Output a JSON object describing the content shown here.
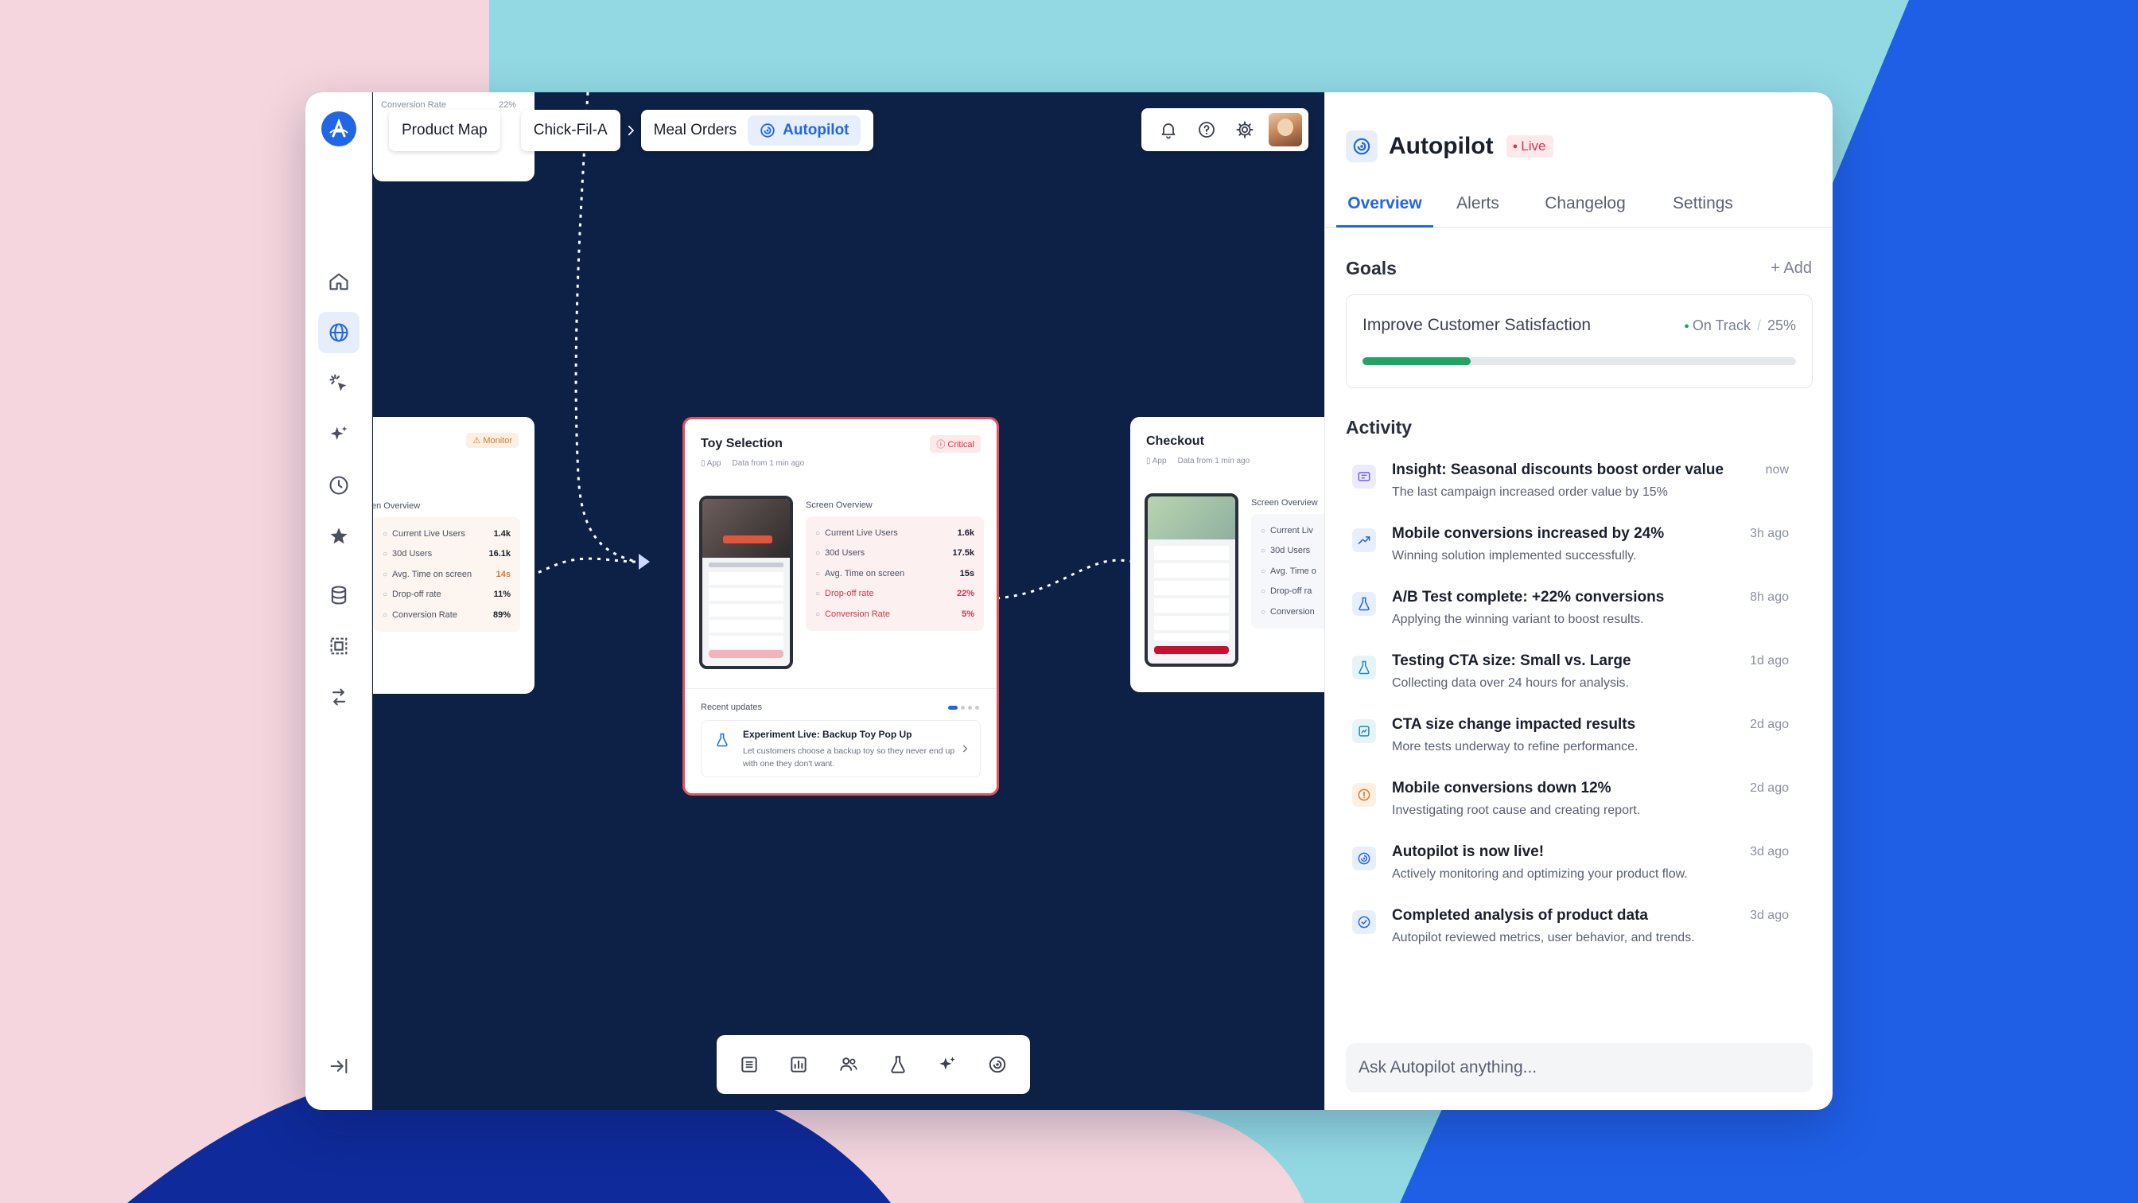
{
  "breadcrumbs": {
    "items": [
      "Product Map",
      "Chick-Fil-A",
      "Meal Orders"
    ],
    "active_pill": "Autopilot"
  },
  "canvas": {
    "partial_top_card": {
      "label": "Conversion Rate",
      "value": "22%"
    },
    "left_card": {
      "badge": "Monitor",
      "overview_title": "en Overview",
      "metrics": [
        {
          "label": "Current Live Users",
          "value": "1.4k"
        },
        {
          "label": "30d Users",
          "value": "16.1k"
        },
        {
          "label": "Avg. Time on screen",
          "value": "14s"
        },
        {
          "label": "Drop-off rate",
          "value": "11%"
        },
        {
          "label": "Conversion Rate",
          "value": "89%"
        }
      ]
    },
    "center_card": {
      "title": "Toy Selection",
      "badge": "Critical",
      "meta_platform": "App",
      "meta_data": "Data from 1 min ago",
      "overview_title": "Screen Overview",
      "metrics": [
        {
          "label": "Current Live Users",
          "value": "1.6k"
        },
        {
          "label": "30d Users",
          "value": "17.5k"
        },
        {
          "label": "Avg. Time on screen",
          "value": "15s"
        },
        {
          "label": "Drop-off rate",
          "value": "22%"
        },
        {
          "label": "Conversion Rate",
          "value": "5%"
        }
      ],
      "updates_title": "Recent updates",
      "update_title": "Experiment Live: Backup Toy Pop Up",
      "update_desc": "Let customers choose a backup toy so they never end up with one they don't want."
    },
    "right_card": {
      "title": "Checkout",
      "meta_platform": "App",
      "meta_data": "Data from 1 min ago",
      "overview_title": "Screen Overview",
      "metrics": [
        {
          "label": "Current Liv"
        },
        {
          "label": "30d Users"
        },
        {
          "label": "Avg. Time o"
        },
        {
          "label": "Drop-off ra"
        },
        {
          "label": "Conversion"
        }
      ]
    }
  },
  "panel": {
    "title": "Autopilot",
    "live_badge": "Live",
    "tabs": [
      "Overview",
      "Alerts",
      "Changelog",
      "Settings"
    ],
    "goals": {
      "title": "Goals",
      "add_label": "+ Add",
      "items": [
        {
          "name": "Improve Customer Satisfaction",
          "status": "On Track",
          "percent": "25%",
          "progress": 0.25
        }
      ]
    },
    "activity": {
      "title": "Activity",
      "items": [
        {
          "title": "Insight: Seasonal discounts boost order value",
          "desc": "The last campaign increased order value by 15%",
          "time": "now",
          "icon": "insight-icon"
        },
        {
          "title": "Mobile conversions increased by 24%",
          "desc": "Winning solution implemented successfully.",
          "time": "3h ago",
          "icon": "trend-up-icon"
        },
        {
          "title": "A/B Test complete: +22% conversions",
          "desc": "Applying the winning variant to boost results.",
          "time": "8h ago",
          "icon": "flask-icon"
        },
        {
          "title": "Testing CTA size: Small vs. Large",
          "desc": "Collecting data over 24 hours for analysis.",
          "time": "1d ago",
          "icon": "beaker-icon"
        },
        {
          "title": "CTA size change impacted results",
          "desc": "More tests underway to refine performance.",
          "time": "2d ago",
          "icon": "chart-icon"
        },
        {
          "title": "Mobile conversions down 12%",
          "desc": "Investigating root cause and creating report.",
          "time": "2d ago",
          "icon": "alert-icon"
        },
        {
          "title": "Autopilot is now live!",
          "desc": "Actively monitoring and optimizing your product flow.",
          "time": "3d ago",
          "icon": "autopilot-icon"
        },
        {
          "title": "Completed analysis of product data",
          "desc": "Autopilot reviewed metrics, user behavior, and trends.",
          "time": "3d ago",
          "icon": "check-circle-icon"
        }
      ]
    },
    "ask_placeholder": "Ask Autopilot anything..."
  },
  "colors": {
    "accent": "#2166e5",
    "canvas_bg": "#0d2045",
    "critical": "#d63649",
    "monitor": "#d97a2b",
    "success": "#1fa463"
  }
}
